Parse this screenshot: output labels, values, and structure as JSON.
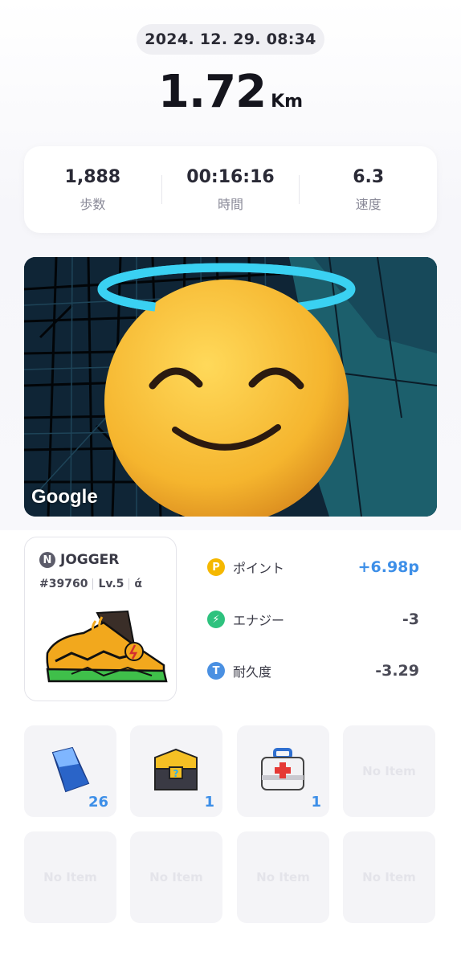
{
  "record": {
    "datetime": "2024. 12. 29. 08:34",
    "distance": "1.72",
    "distance_unit": "Km"
  },
  "stats": [
    {
      "value": "1,888",
      "label": "歩数"
    },
    {
      "value": "00:16:16",
      "label": "時間"
    },
    {
      "value": "6.3",
      "label": "速度"
    }
  ],
  "map": {
    "attribution": "Google",
    "overlay_icon": "smiling-face-with-halo-emoji"
  },
  "shoe": {
    "type_badge": "N",
    "type": "JOGGER",
    "id": "#39760",
    "level": "Lv.5",
    "extra_glyph": "ά"
  },
  "rewards": [
    {
      "icon_letter": "P",
      "icon": "point-coin-icon",
      "label": "ポイント",
      "amount": "+6.98p",
      "color": "#f5b800"
    },
    {
      "icon_letter": "⚡",
      "icon": "energy-icon",
      "label": "エナジー",
      "amount": "-3",
      "color": "#2ec27e"
    },
    {
      "icon_letter": "T",
      "icon": "durability-icon",
      "label": "耐久度",
      "amount": "-3.29",
      "color": "#4a90e2"
    }
  ],
  "items": [
    {
      "icon": "blue-gem-icon",
      "count": "26"
    },
    {
      "icon": "mystery-box-icon",
      "count": "1"
    },
    {
      "icon": "first-aid-kit-icon",
      "count": "1"
    },
    {
      "empty_label": "No Item"
    },
    {
      "empty_label": "No Item"
    },
    {
      "empty_label": "No Item"
    },
    {
      "empty_label": "No Item"
    },
    {
      "empty_label": "No Item"
    }
  ]
}
